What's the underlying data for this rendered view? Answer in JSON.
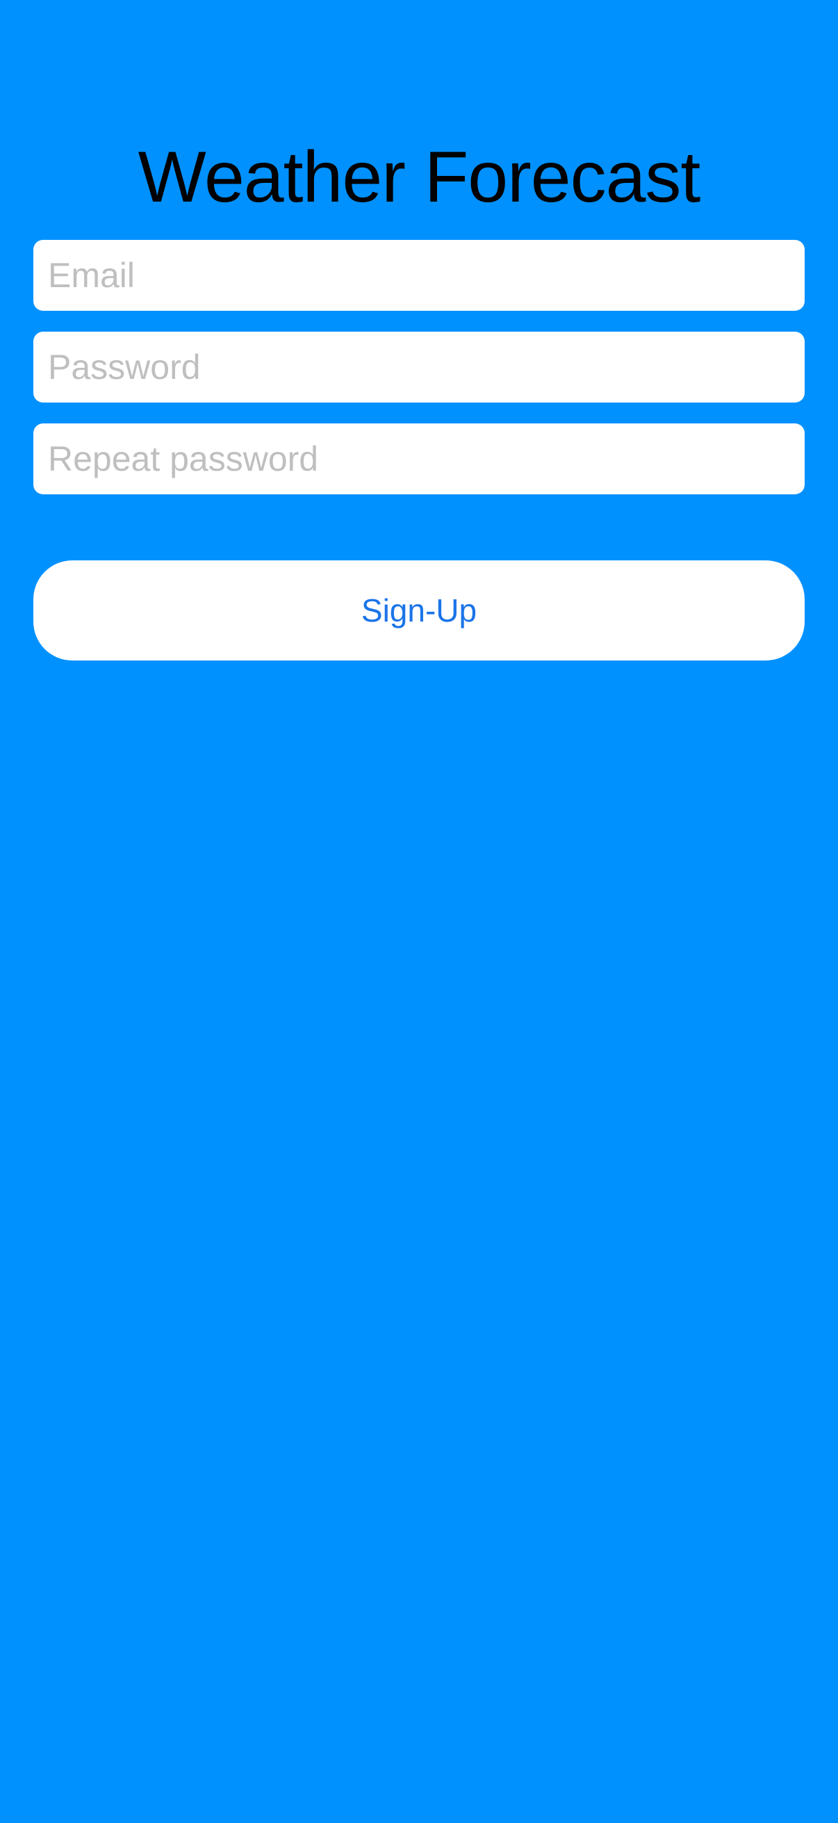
{
  "header": {
    "title": "Weather Forecast"
  },
  "form": {
    "email_placeholder": "Email",
    "password_placeholder": "Password",
    "repeat_password_placeholder": "Repeat password",
    "signup_label": "Sign-Up"
  },
  "colors": {
    "background": "#0091FF",
    "field_background": "#FFFFFF",
    "placeholder": "#BFBFBF",
    "button_text": "#1A74E8",
    "title_text": "#000000"
  }
}
